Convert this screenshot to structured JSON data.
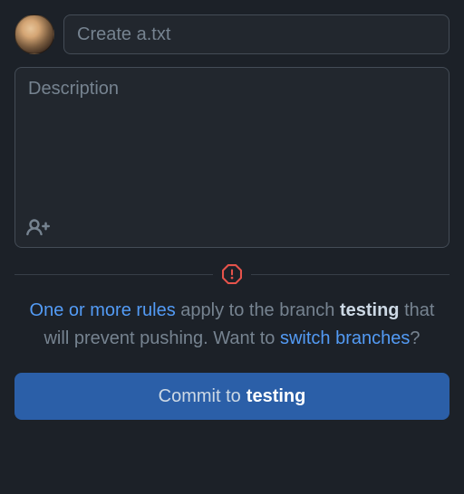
{
  "commit_form": {
    "summary_placeholder": "Create a.txt",
    "description_placeholder": "Description"
  },
  "warning": {
    "rules_link": "One or more rules",
    "text_1": " apply to the branch ",
    "branch_name": "testing",
    "text_2": " that will prevent pushing. Want to ",
    "switch_link": "switch branches",
    "text_3": "?"
  },
  "commit_button": {
    "prefix": "Commit to ",
    "branch": "testing"
  }
}
